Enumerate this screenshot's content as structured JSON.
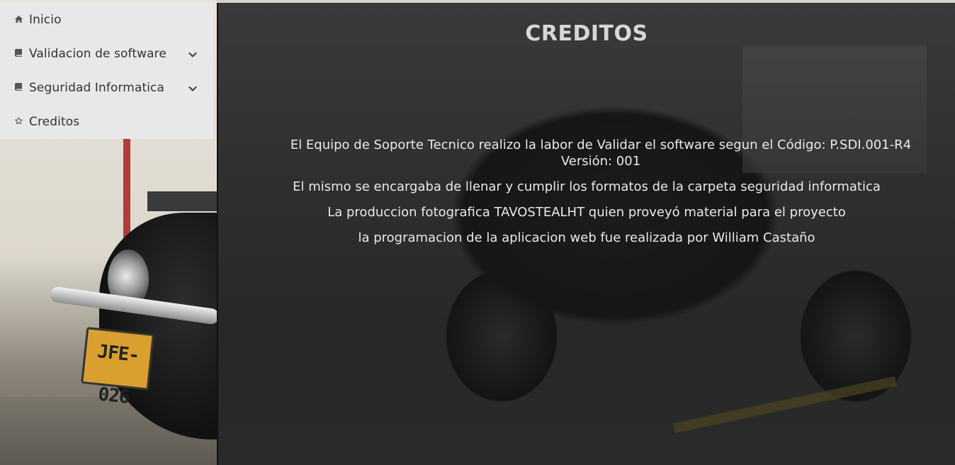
{
  "sidebar": {
    "items": [
      {
        "label": "Inicio",
        "icon": "home-icon",
        "has_submenu": false
      },
      {
        "label": "Validacion de software",
        "icon": "book-icon",
        "has_submenu": true
      },
      {
        "label": "Seguridad Informatica",
        "icon": "book-icon",
        "has_submenu": true
      },
      {
        "label": "Creditos",
        "icon": "star-icon",
        "has_submenu": false
      }
    ]
  },
  "main": {
    "title": "CREDITOS",
    "credits": [
      "El Equipo de Soporte Tecnico realizo la labor de Validar el software segun el Código: P.SDI.001-R4",
      "Versión: 001",
      "El mismo se encargaba de llenar y cumplir los formatos de la carpeta seguridad informatica",
      "La produccion fotografica TAVOSTEALHT quien proveyó material para el proyecto",
      "la programacion de la aplicacion web fue realizada por William Castaño"
    ]
  },
  "background": {
    "plate_text": "JFE-026"
  },
  "colors": {
    "sidebar_bg": "#e8e8e8",
    "menu_text": "#333333",
    "content_text": "#e9e9e9",
    "title_text": "#d7d7d7"
  }
}
